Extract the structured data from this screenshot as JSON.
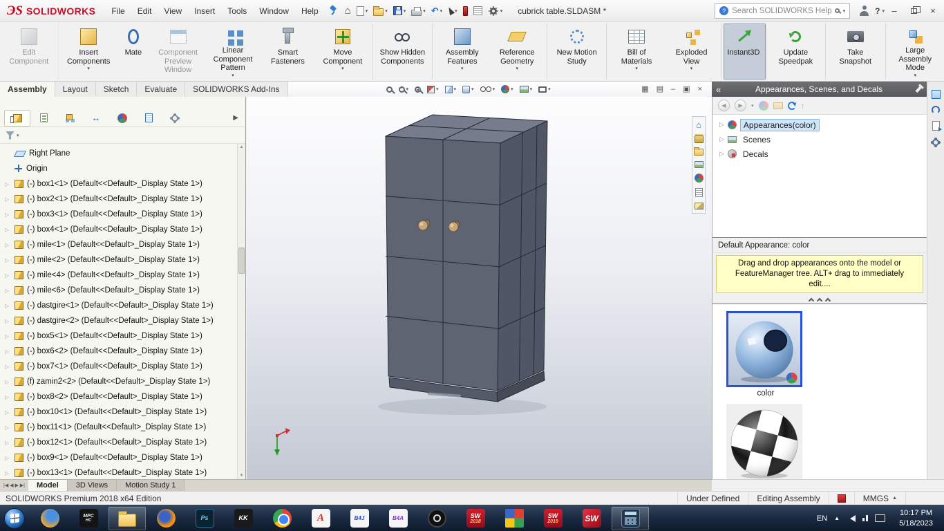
{
  "colors": {
    "solidworks_red": "#c8102e",
    "selection_blue": "#cfe5fa",
    "tip_yellow": "#ffffc6",
    "taskbar_bg": "#16243a",
    "instant3d_active": "#c5cdd8"
  },
  "titlebar": {
    "logo": {
      "ds": "ЭS",
      "text": "SOLIDWORKS"
    },
    "menus": [
      "File",
      "Edit",
      "View",
      "Insert",
      "Tools",
      "Window",
      "Help"
    ],
    "quick_access": [
      {
        "name": "home-icon",
        "cls": "qa-home"
      },
      {
        "name": "new-document-icon",
        "cls": "qa-page",
        "caret": true
      },
      {
        "name": "open-icon",
        "cls": "qa-folder",
        "caret": true
      },
      {
        "name": "save-icon",
        "cls": "qa-save",
        "caret": true
      },
      {
        "name": "print-icon",
        "cls": "qa-print",
        "caret": true
      },
      {
        "name": "undo-icon",
        "cls": "qa-undo",
        "caret": true
      },
      {
        "name": "select-cursor-icon",
        "cls": "qa-cursor",
        "caret": true
      },
      {
        "name": "toolbox-icon",
        "cls": "qa-toolbox"
      },
      {
        "name": "task-list-icon",
        "cls": "qa-list"
      },
      {
        "name": "options-gear-icon",
        "cls": "qa-gear",
        "caret": true
      }
    ],
    "doc_title": "cubrick table.SLDASM *",
    "search_placeholder": "Search SOLIDWORKS Help",
    "help_label": "?"
  },
  "ribbon": {
    "buttons": [
      {
        "name": "edit-component-button",
        "label": "Edit Component",
        "icon": "ic-cube-gray",
        "disabled": true,
        "sep": true
      },
      {
        "name": "insert-components-button",
        "label": "Insert Components",
        "icon": "ic-cube-yellow",
        "caret": true
      },
      {
        "name": "mate-button",
        "label": "Mate",
        "icon": "ic-mate"
      },
      {
        "name": "component-preview-window-button",
        "label": "Component Preview Window",
        "icon": "ic-window",
        "disabled": true
      },
      {
        "name": "linear-component-pattern-button",
        "label": "Linear Component Pattern",
        "icon": "ic-pattern",
        "caret": true
      },
      {
        "name": "smart-fasteners-button",
        "label": "Smart Fasteners",
        "icon": "ic-bolt"
      },
      {
        "name": "move-component-button",
        "label": "Move Component",
        "icon": "ic-move",
        "caret": true,
        "sep": true
      },
      {
        "name": "show-hidden-components-button",
        "label": "Show Hidden Components",
        "icon": "ic-glasses",
        "sep": true
      },
      {
        "name": "assembly-features-button",
        "label": "Assembly Features",
        "icon": "ic-feat",
        "caret": true
      },
      {
        "name": "reference-geometry-button",
        "label": "Reference Geometry",
        "icon": "ic-refgeo",
        "caret": true,
        "sep": true
      },
      {
        "name": "new-motion-study-button",
        "label": "New Motion Study",
        "icon": "ic-motion",
        "sep": true
      },
      {
        "name": "bill-of-materials-button",
        "label": "Bill of Materials",
        "icon": "ic-bom",
        "caret": true
      },
      {
        "name": "exploded-view-button",
        "label": "Exploded View",
        "icon": "ic-explode",
        "caret": true,
        "sep": true
      },
      {
        "name": "instant3d-button",
        "label": "Instant3D",
        "icon": "ic-instant3d",
        "active": true,
        "sep": true
      },
      {
        "name": "update-speedpak-button",
        "label": "Update Speedpak",
        "icon": "ic-speedpak",
        "sep": true
      },
      {
        "name": "take-snapshot-button",
        "label": "Take Snapshot",
        "icon": "ic-snapshot",
        "sep": true
      },
      {
        "name": "large-assembly-mode-button",
        "label": "Large Assembly Mode",
        "icon": "ic-lam",
        "caret": true
      }
    ]
  },
  "cmd_tabs": {
    "items": [
      {
        "name": "tab-assembly",
        "label": "Assembly",
        "active": true
      },
      {
        "name": "tab-layout",
        "label": "Layout"
      },
      {
        "name": "tab-sketch",
        "label": "Sketch"
      },
      {
        "name": "tab-evaluate",
        "label": "Evaluate"
      },
      {
        "name": "tab-solidworks-add-ins",
        "label": "SOLIDWORKS Add-Ins"
      }
    ]
  },
  "hud": {
    "items": [
      {
        "name": "zoom-fit-icon",
        "icon": "hmag"
      },
      {
        "name": "zoom-area-icon",
        "icon": "hmagplus",
        "caret": true
      },
      {
        "name": "previous-view-icon",
        "icon": "hprev"
      },
      {
        "name": "section-view-icon",
        "icon": "hsection",
        "caret": true
      },
      {
        "name": "view-orientation-icon",
        "icon": "hcube",
        "caret": true
      },
      {
        "name": "display-style-icon",
        "icon": "hstyle",
        "caret": true
      },
      {
        "name": "hide-show-items-icon",
        "icon": "hglasses",
        "caret": true
      },
      {
        "name": "edit-appearance-icon",
        "icon": "hball",
        "caret": true
      },
      {
        "name": "apply-scene-icon",
        "icon": "hscene",
        "caret": true
      },
      {
        "name": "view-settings-icon",
        "icon": "hmonitor",
        "caret": true
      }
    ]
  },
  "doc_controls": [
    {
      "name": "viewport-layout-icon",
      "glyph": "▦"
    },
    {
      "name": "viewport-single-icon",
      "glyph": "▤"
    },
    {
      "name": "minimize-document-icon",
      "glyph": "–"
    },
    {
      "name": "restore-document-icon",
      "glyph": "▣"
    },
    {
      "name": "close-document-icon",
      "glyph": "×"
    }
  ],
  "manager_tabs": [
    {
      "name": "featuremanager-tab-icon",
      "cls": "mt1",
      "active": true
    },
    {
      "name": "propertymanager-tab-icon",
      "cls": "mt2"
    },
    {
      "name": "configurationmanager-tab-icon",
      "cls": "mt3"
    },
    {
      "name": "dimxpertmanager-tab-icon",
      "cls": "mt4"
    },
    {
      "name": "displaymanager-tab-icon",
      "cls": "mt5"
    },
    {
      "name": "cam-tab-icon",
      "cls": "mt6"
    },
    {
      "name": "tools-tab-icon",
      "cls": "mt7"
    }
  ],
  "feature_tree": {
    "plane": "Right Plane",
    "origin": "Origin",
    "components": [
      "(-) box1<1> (Default<<Default>_Display State 1>)",
      "(-) box2<1> (Default<<Default>_Display State 1>)",
      "(-) box3<1> (Default<<Default>_Display State 1>)",
      "(-) box4<1> (Default<<Default>_Display State 1>)",
      "(-) mile<1> (Default<<Default>_Display State 1>)",
      "(-) mile<2> (Default<<Default>_Display State 1>)",
      "(-) mile<4> (Default<<Default>_Display State 1>)",
      "(-) mile<6> (Default<<Default>_Display State 1>)",
      "(-) dastgire<1> (Default<<Default>_Display State 1>)",
      "(-) dastgire<2> (Default<<Default>_Display State 1>)",
      "(-) box5<1> (Default<<Default>_Display State 1>)",
      "(-) box6<2> (Default<<Default>_Display State 1>)",
      "(-) box7<1> (Default<<Default>_Display State 1>)",
      "(f) zamin2<2> (Default<<Default>_Display State 1>)",
      "(-) box8<2> (Default<<Default>_Display State 1>)",
      "(-) box10<1> (Default<<Default>_Display State 1>)",
      "(-) box11<1> (Default<<Default>_Display State 1>)",
      "(-) box12<1> (Default<<Default>_Display State 1>)",
      "(-) box9<1> (Default<<Default>_Display State 1>)",
      "(-) box13<1> (Default<<Default>_Display State 1>)"
    ]
  },
  "side_tabs": [
    {
      "name": "resources-home-icon",
      "cls": "st-home"
    },
    {
      "name": "design-library-icon",
      "cls": "st-lib"
    },
    {
      "name": "file-explorer-panel-icon",
      "cls": "st-folder"
    },
    {
      "name": "view-palette-icon",
      "cls": "st-palette"
    },
    {
      "name": "appearances-panel-icon",
      "cls": "st-ball"
    },
    {
      "name": "custom-properties-icon",
      "cls": "st-props"
    },
    {
      "name": "forum-icon",
      "cls": "st-photo"
    }
  ],
  "task_pane": {
    "title": "Appearances, Scenes, and Decals",
    "tree": [
      {
        "name": "appearances-node",
        "label": "Appearances(color)",
        "icon": "tball",
        "selected": true
      },
      {
        "name": "scenes-node",
        "label": "Scenes",
        "icon": "tscene"
      },
      {
        "name": "decals-node",
        "label": "Decals",
        "icon": "tdecal"
      }
    ],
    "default_appearance": "Default Appearance: color",
    "tip": "Drag and drop appearances onto the model or FeatureManager tree.  ALT+ drag to immediately edit....",
    "thumb1_label": "color"
  },
  "far_icons": [
    {
      "name": "community-panel-icon",
      "cls": "fs1"
    },
    {
      "name": "sync-panel-icon",
      "cls": "fs2"
    },
    {
      "name": "export-panel-icon",
      "cls": "fs3"
    },
    {
      "name": "settings-panel-icon",
      "cls": "fs4"
    }
  ],
  "model_tabs": {
    "items": [
      {
        "name": "model-tab",
        "label": "Model",
        "active": true
      },
      {
        "name": "3d-views-tab",
        "label": "3D Views"
      },
      {
        "name": "motion-study-tab",
        "label": "Motion Study 1"
      }
    ]
  },
  "statusbar": {
    "left": "SOLIDWORKS Premium 2018 x64 Edition",
    "state": "Under Defined",
    "mode": "Editing Assembly",
    "units": "MMGS"
  },
  "taskbar": {
    "apps": [
      {
        "name": "browser-icon",
        "cls": "tk-browser"
      },
      {
        "name": "media-player-icon",
        "cls": "tk-mpc",
        "l1": "MPC",
        "l2": "HC"
      },
      {
        "name": "file-explorer-icon",
        "cls": "tk-folder",
        "open": true
      },
      {
        "name": "firefox-icon",
        "cls": "tk-firefox"
      },
      {
        "name": "photoshop-icon",
        "cls": "tk-ps",
        "l1": "Ps"
      },
      {
        "name": "kmplayer-icon",
        "cls": "tk-kk",
        "l1": "KK"
      },
      {
        "name": "chrome-icon",
        "cls": "tk-chrome"
      },
      {
        "name": "adobe-reader-icon",
        "cls": "tk-a",
        "l1": "A"
      },
      {
        "name": "b4j-icon",
        "cls": "tk-b4j",
        "l1": "B4J"
      },
      {
        "name": "b4a-icon",
        "cls": "tk-b4a",
        "l1": "B4A"
      },
      {
        "name": "camera-app-icon",
        "cls": "tk-cam"
      },
      {
        "name": "solidworks-2018-icon",
        "cls": "tk-sw",
        "l1": "SW",
        "l2": "2018"
      },
      {
        "name": "color-grid-icon",
        "cls": "tk-grid"
      },
      {
        "name": "solidworks-2019-icon",
        "cls": "tk-sw",
        "l1": "SW",
        "l2": "2019"
      },
      {
        "name": "solidworks-icon",
        "cls": "tk-sw2",
        "l1": "SW"
      },
      {
        "name": "calculator-icon",
        "cls": "tk-calc",
        "open": true
      }
    ],
    "tray": {
      "lang": "EN",
      "time": "10:17 PM",
      "date": "5/18/2023"
    }
  }
}
